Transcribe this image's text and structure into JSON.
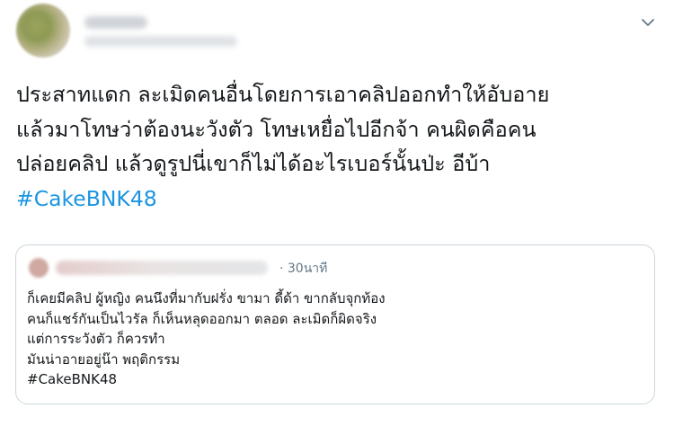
{
  "tweet": {
    "more_icon": "chevron-down-icon",
    "text_lines": [
      "ประสาทแดก ละเมิดคนอื่นโดยการเอาคลิปออกทำให้อับอาย",
      "แล้วมาโทษว่าต้องนะวังตัว โทษเหยื่อไปอีกจ้า คนผิดคือคน",
      "ปล่อยคลิป แล้วดูรูปนี่เขาก็ไม่ได้อะไรเบอร์นั้นป่ะ อีบ้า"
    ],
    "hashtag": "#CakeBNK48"
  },
  "quoted_tweet": {
    "time": "· 30นาที",
    "text_lines": [
      "ก็เคยมีคลิป ผู้หญิง คนนึงที่มากับฝรั่ง ขามา ดี้ด้า ขากลับจุกท้อง",
      "คนก็แชร์กันเป็นไวรัล ก็เห็นหลุดออกมา ตลอด ละเมิดก็ผิดจริง",
      "แต่การระวังตัว ก็ควรทำ",
      "มันน่าอายอยู่น๊า พฤติกรรม",
      "#CakeBNK48"
    ]
  },
  "colors": {
    "text": "#14171a",
    "link": "#1b95e0",
    "muted": "#657786",
    "border": "#ccd6dd"
  }
}
